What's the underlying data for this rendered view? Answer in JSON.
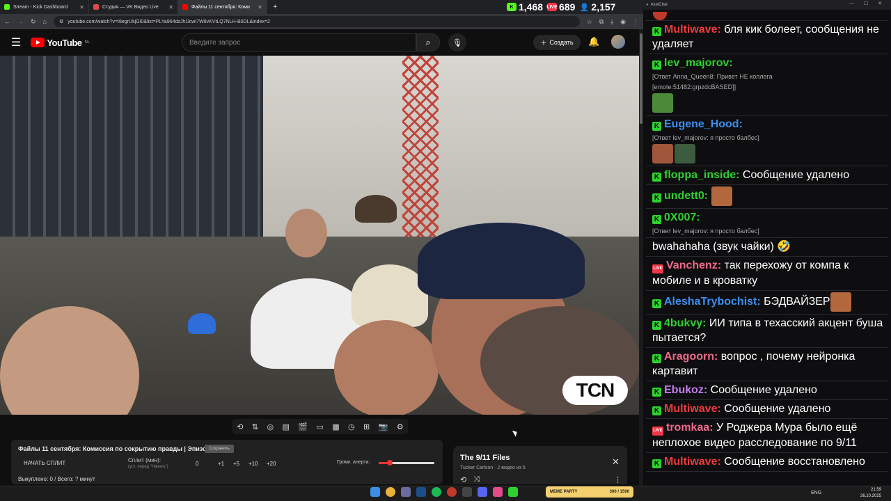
{
  "browser": {
    "tabs": [
      {
        "title": "Stream - Kick Dashboard",
        "color": "#53fc18"
      },
      {
        "title": "Студия — VK Видео Live",
        "color": "#e24a4a"
      },
      {
        "title": "Файлы 11 сентября: Коми",
        "color": "#ff0000"
      }
    ],
    "new_tab": "+",
    "url": "youtube.com/watch?v=I8egrUkjGI0&list=PLYa964dzJh1lcwI7W8vKVtLQ7NLH-B0DL&index=2"
  },
  "counters": [
    {
      "icon": "kick-icon",
      "value": "1,468",
      "color": "#53fc18"
    },
    {
      "icon": "vk-live-icon",
      "value": "689",
      "color": "#f0364a"
    },
    {
      "icon": "viewers-icon",
      "value": "2,157",
      "color": "#3b82f6"
    }
  ],
  "youtube": {
    "logo": "YouTube",
    "region": "NL",
    "search_placeholder": "Введите запрос",
    "create_label": "Создать"
  },
  "video": {
    "watermark": "TCN"
  },
  "extension": {
    "title": "Файлы 11 сентября: Комиссия по сокрытию правды | Эпизод 2",
    "save_label": "Сохранить",
    "start_split": "НАЧАТЬ СПЛИТ",
    "split_label": "Сплит (мин):",
    "split_hint": "(уст. перед \"Начать\")",
    "split_value": "0",
    "increments": [
      "+1",
      "+5",
      "+10",
      "+20"
    ],
    "alert_volume_label": "Громк. алерта:",
    "alert_volume": 0.2,
    "bought_summary": "Выкуплено: 0 / Всего: ? минут"
  },
  "playlist": {
    "title": "The 9/11 Files",
    "subtitle": "Tucker Carlson · 2 видео из 5"
  },
  "chat": {
    "window_title": "AxelChat",
    "messages": [
      {
        "platform": "kick",
        "nick": "Multiwave",
        "color": "#f03c3c",
        "text": "бля кик болеет, сообщения не удаляет"
      },
      {
        "platform": "kick",
        "nick": "lev_majorov",
        "color": "#2fd12f",
        "text": "",
        "reply": "[Ответ Anna_Queen8: Привет НЕ коллега",
        "extra": "[emote:51482:grpzdcBASED]]",
        "emotes": [
          "pepe-emote"
        ]
      },
      {
        "platform": "kick",
        "nick": "Eugene_Hood",
        "color": "#3d8ef0",
        "text": "",
        "reply": "[Ответ lev_majorov: я просто балбес]",
        "emotes": [
          "face-emote",
          "frog-emote"
        ]
      },
      {
        "platform": "kick",
        "nick": "floppa_inside",
        "color": "#2fd12f",
        "text": "Сообщение удалено"
      },
      {
        "platform": "kick",
        "nick": "undett0",
        "color": "#2fd12f",
        "text": "",
        "emotes": [
          "laugh-emote"
        ]
      },
      {
        "platform": "kick",
        "nick": "0X007",
        "color": "#2fd12f",
        "text": "",
        "reply": "[Ответ lev_majorov: я просто балбес]"
      },
      {
        "platform": "none",
        "nick": "",
        "color": "#ffffff",
        "text": "bwahahaha (звук чайки) 🤣"
      },
      {
        "platform": "live",
        "nick": "Vanchenz",
        "color": "#f06a8a",
        "text": "так перехожу от компа к мобиле и в кроватку"
      },
      {
        "platform": "kick",
        "nick": "AleshaTrybochist",
        "color": "#3d8ef0",
        "text": "БЭДВАЙЗЕР",
        "emotes": [
          "laugh-emote"
        ]
      },
      {
        "platform": "kick",
        "nick": "4bukvy",
        "color": "#2fd12f",
        "text": "ИИ типа в техасский акцент буша пытается?"
      },
      {
        "platform": "kick",
        "nick": "Aragoorn",
        "color": "#f06a8a",
        "text": "вопрос , почему нейронка картавит"
      },
      {
        "platform": "kick",
        "nick": "Ebukoz",
        "color": "#c27ef0",
        "text": "Сообщение удалено"
      },
      {
        "platform": "kick",
        "nick": "Multiwave",
        "color": "#f03c3c",
        "text": "Сообщение удалено"
      },
      {
        "platform": "live",
        "nick": "tromkaa",
        "color": "#f06a8a",
        "text": "У Роджера Мура было ещё неплохое видео расследование по 9/11"
      },
      {
        "platform": "kick",
        "nick": "Multiwave",
        "color": "#f03c3c",
        "text": "Сообщение восстановлено"
      }
    ]
  },
  "taskbar": {
    "tray_app": "MEME PARTY",
    "tray_status": "300 / 1500",
    "lang": "ENG",
    "time": "21:59",
    "date": "26.10.2025"
  }
}
